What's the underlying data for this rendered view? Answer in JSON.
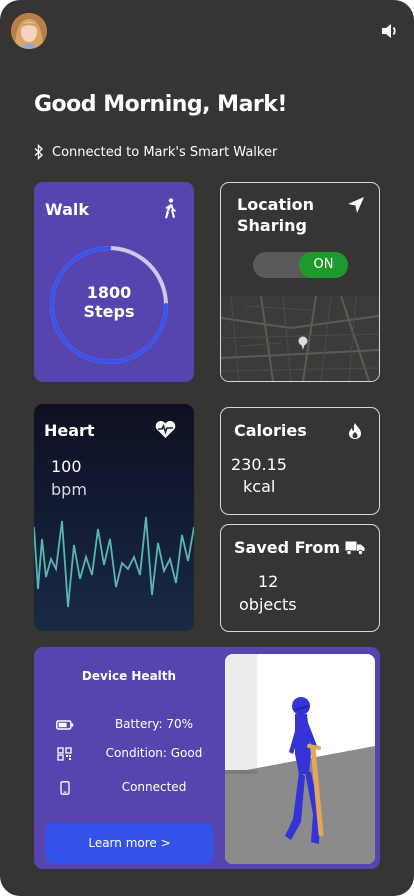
{
  "header": {
    "greeting": "Good Morning, Mark!",
    "connection_status": "Connected to Mark's Smart Walker",
    "avatar_icon": "user-avatar",
    "sound_icon": "speaker-icon"
  },
  "walk": {
    "title": "Walk",
    "steps_value": "1800",
    "steps_unit": "Steps",
    "progress": 0.75,
    "icon": "walking-person-icon"
  },
  "location": {
    "title_line1": "Location",
    "title_line2": "Sharing",
    "toggle_label": "ON",
    "toggle_on": true,
    "icon": "navigation-arrow-icon"
  },
  "heart": {
    "title": "Heart",
    "value": "100",
    "unit": "bpm",
    "icon": "heartbeat-icon"
  },
  "calories": {
    "title": "Calories",
    "value": "230.15",
    "unit": "kcal",
    "icon": "flame-icon"
  },
  "saved_from": {
    "title": "Saved From",
    "value": "12",
    "unit": "objects",
    "icon": "truck-icon"
  },
  "device_health": {
    "title": "Device Health",
    "battery": "Battery: 70%",
    "condition": "Condition: Good",
    "connection": "Connected",
    "button": "Learn more >"
  },
  "colors": {
    "background": "#363534",
    "card_purple": "#5844ae",
    "accent_blue": "#3452e8",
    "toggle_green": "#1e9a2d"
  }
}
